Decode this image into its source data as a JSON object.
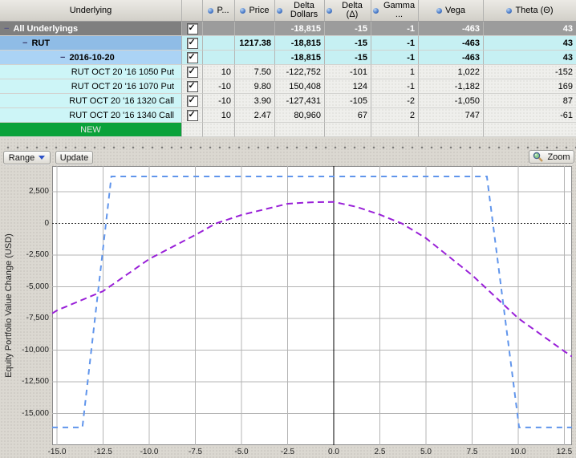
{
  "table": {
    "header": {
      "cols": [
        "Underlying",
        "",
        "P...",
        "Price",
        "Delta Dollars",
        "Delta (Δ)",
        "Gamma ...",
        "Vega",
        "Theta (Θ)"
      ]
    },
    "rows": [
      {
        "label": "All Underlyings",
        "checked": true,
        "pos": "",
        "price": "",
        "dd": "-18,815",
        "delta": "-15",
        "gamma": "-1",
        "vega": "-463",
        "theta": "43"
      },
      {
        "label": "RUT",
        "checked": true,
        "pos": "",
        "price": "1217.38",
        "dd": "-18,815",
        "delta": "-15",
        "gamma": "-1",
        "vega": "-463",
        "theta": "43"
      },
      {
        "label": "2016-10-20",
        "checked": true,
        "pos": "",
        "price": "",
        "dd": "-18,815",
        "delta": "-15",
        "gamma": "-1",
        "vega": "-463",
        "theta": "43"
      },
      {
        "label": "RUT OCT 20 '16 1050 Put",
        "checked": true,
        "pos": "10",
        "price": "7.50",
        "dd": "-122,752",
        "delta": "-101",
        "gamma": "1",
        "vega": "1,022",
        "theta": "-152"
      },
      {
        "label": "RUT OCT 20 '16 1070 Put",
        "checked": true,
        "pos": "-10",
        "price": "9.80",
        "dd": "150,408",
        "delta": "124",
        "gamma": "-1",
        "vega": "-1,182",
        "theta": "169"
      },
      {
        "label": "RUT OCT 20 '16 1320 Call",
        "checked": true,
        "pos": "-10",
        "price": "3.90",
        "dd": "-127,431",
        "delta": "-105",
        "gamma": "-2",
        "vega": "-1,050",
        "theta": "87"
      },
      {
        "label": "RUT OCT 20 '16 1340 Call",
        "checked": true,
        "pos": "10",
        "price": "2.47",
        "dd": "80,960",
        "delta": "67",
        "gamma": "2",
        "vega": "747",
        "theta": "-61"
      },
      {
        "label": "NEW"
      }
    ],
    "colors": {
      "summary_row": "#9c9c9c",
      "underlying_row": "#8fbce6",
      "expiry_row": "#abd3f5",
      "option_label_cell": "#cdf5f7",
      "new_row_green": "#0aa23a"
    }
  },
  "toolbar": {
    "range_label": "Range",
    "update_label": "Update",
    "zoom_label": "Zoom"
  },
  "chart_data": {
    "type": "line",
    "title": "",
    "xlabel": "",
    "ylabel": "Equity Portfolio Value Change (USD)",
    "grid": true,
    "legend": "none",
    "xlim": [
      -15.26,
      12.91
    ],
    "ylim": [
      -17500,
      4540
    ],
    "current_x_marker": 0,
    "x_ticks": [
      -15,
      -12.5,
      -10,
      -7.5,
      -5,
      -2.5,
      0,
      2.5,
      5,
      7.5,
      10,
      12.5
    ],
    "x_tick_labels": [
      "-15.0",
      "-12.5",
      "-10.0",
      "-7.5",
      "-5.0",
      "-2.5",
      "0.0",
      "2.5",
      "5.0",
      "7.5",
      "10.0",
      "12.5"
    ],
    "y_ticks": [
      2500,
      0,
      -2500,
      -5000,
      -7500,
      -10000,
      -12500,
      -15000
    ],
    "y_tick_labels": [
      "2,500",
      "0",
      "-2,500",
      "-5,000",
      "-7,500",
      "-10,000",
      "-12,500",
      "-15,000"
    ],
    "series": [
      {
        "name": "blue-dashed-line",
        "color": "#6095ec",
        "dash": "7,6",
        "points": [
          [
            -15.26,
            -16100
          ],
          [
            -13.62,
            -16100
          ],
          [
            -12.05,
            3720
          ],
          [
            8.3,
            3720
          ],
          [
            10.05,
            -16100
          ],
          [
            12.91,
            -16100
          ]
        ]
      },
      {
        "name": "purple-dashed-line",
        "color": "#9920d8",
        "dash": "8,5",
        "points": [
          [
            -15.26,
            -7100
          ],
          [
            -15,
            -6860
          ],
          [
            -12.5,
            -5340
          ],
          [
            -10,
            -2800
          ],
          [
            -7.5,
            -900
          ],
          [
            -6.4,
            0
          ],
          [
            -5,
            680
          ],
          [
            -2.5,
            1565
          ],
          [
            -1.25,
            1680
          ],
          [
            0,
            1710
          ],
          [
            1.25,
            1310
          ],
          [
            2.5,
            700
          ],
          [
            3.7,
            0
          ],
          [
            5,
            -1160
          ],
          [
            7.5,
            -4075
          ],
          [
            10,
            -7480
          ],
          [
            12.5,
            -10090
          ],
          [
            12.91,
            -10500
          ]
        ]
      }
    ]
  }
}
